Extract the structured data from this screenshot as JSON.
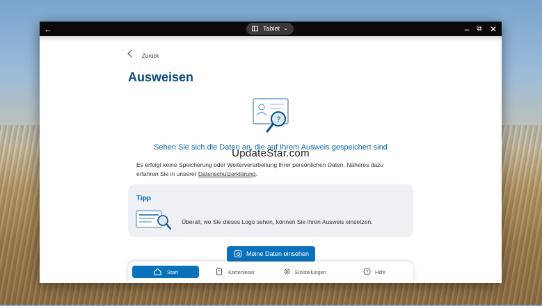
{
  "window": {
    "title_pill": "Tablet"
  },
  "page": {
    "back_label": "Zurück",
    "title": "Ausweisen",
    "headline": "Sehen Sie sich die Daten an, die auf Ihrem Ausweis gespeichert sind",
    "description_line1": "Es erfolgt keine Speicherung oder Weiterverarbeitung Ihrer persönlichen Daten. Näheres dazu",
    "description_line2": "erfahren Sie in unserer",
    "description_link": "Datenschutzerklärung",
    "description_end": "."
  },
  "watermark": "UpdateStar.com",
  "tip": {
    "heading": "Tipp",
    "text": "Überall, wo Sie dieses Logo sehen, können Sie Ihren Ausweis einsetzen."
  },
  "cta": {
    "label": "Meine Daten einsehen"
  },
  "nav": {
    "items": [
      {
        "label": "Start",
        "icon": "home-icon",
        "active": true
      },
      {
        "label": "Kartenleser",
        "icon": "card-reader-icon",
        "active": false
      },
      {
        "label": "Einstellungen",
        "icon": "gear-icon",
        "active": false
      },
      {
        "label": "Hilfe",
        "icon": "help-icon",
        "active": false
      }
    ]
  },
  "colors": {
    "accent": "#0a72bd",
    "title": "#0a4a84",
    "tip_bg": "#eef0f3"
  }
}
